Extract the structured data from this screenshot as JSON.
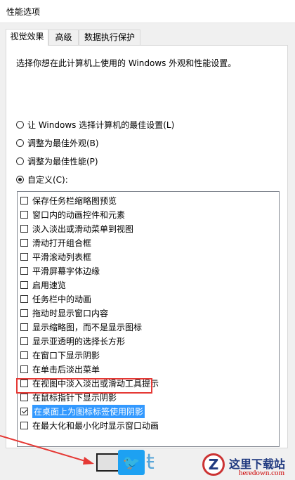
{
  "window": {
    "title": "性能选项"
  },
  "tabs": [
    {
      "label": "视觉效果",
      "active": true
    },
    {
      "label": "高级",
      "active": false
    },
    {
      "label": "数据执行保护",
      "active": false
    }
  ],
  "visual": {
    "description": "选择你想在此计算机上使用的 Windows 外观和性能设置。",
    "options": [
      {
        "label": "让 Windows 选择计算机的最佳设置(L)",
        "checked": false
      },
      {
        "label": "调整为最佳外观(B)",
        "checked": false
      },
      {
        "label": "调整为最佳性能(P)",
        "checked": false
      },
      {
        "label": "自定义(C):",
        "checked": true
      }
    ],
    "items": [
      {
        "label": "保存任务栏缩略图预览",
        "checked": false
      },
      {
        "label": "窗口内的动画控件和元素",
        "checked": false
      },
      {
        "label": "淡入淡出或滑动菜单到视图",
        "checked": false
      },
      {
        "label": "滑动打开组合框",
        "checked": false
      },
      {
        "label": "平滑滚动列表框",
        "checked": false
      },
      {
        "label": "平滑屏幕字体边缘",
        "checked": false
      },
      {
        "label": "启用速览",
        "checked": false
      },
      {
        "label": "任务栏中的动画",
        "checked": false
      },
      {
        "label": "拖动时显示窗口内容",
        "checked": false
      },
      {
        "label": "显示缩略图，而不是显示图标",
        "checked": false
      },
      {
        "label": "显示亚透明的选择长方形",
        "checked": false
      },
      {
        "label": "在窗口下显示阴影",
        "checked": false
      },
      {
        "label": "在单击后淡出菜单",
        "checked": false
      },
      {
        "label": "在视图中淡入淡出或滑动工具提示",
        "checked": false
      },
      {
        "label": "在鼠标指针下显示阴影",
        "checked": false
      },
      {
        "label": "在桌面上为图标标签使用阴影",
        "checked": true,
        "selected": true
      },
      {
        "label": "在最大化和最小化时显示窗口动画",
        "checked": false
      }
    ]
  },
  "watermark": {
    "logo_text": "Z",
    "title": "这里下载站",
    "site": "heredown.com"
  },
  "colors": {
    "highlight": "#e53935",
    "selection": "#3399ff",
    "twitter": "#1da1f2"
  },
  "icons": {
    "social": "twitter-bird-icon"
  }
}
